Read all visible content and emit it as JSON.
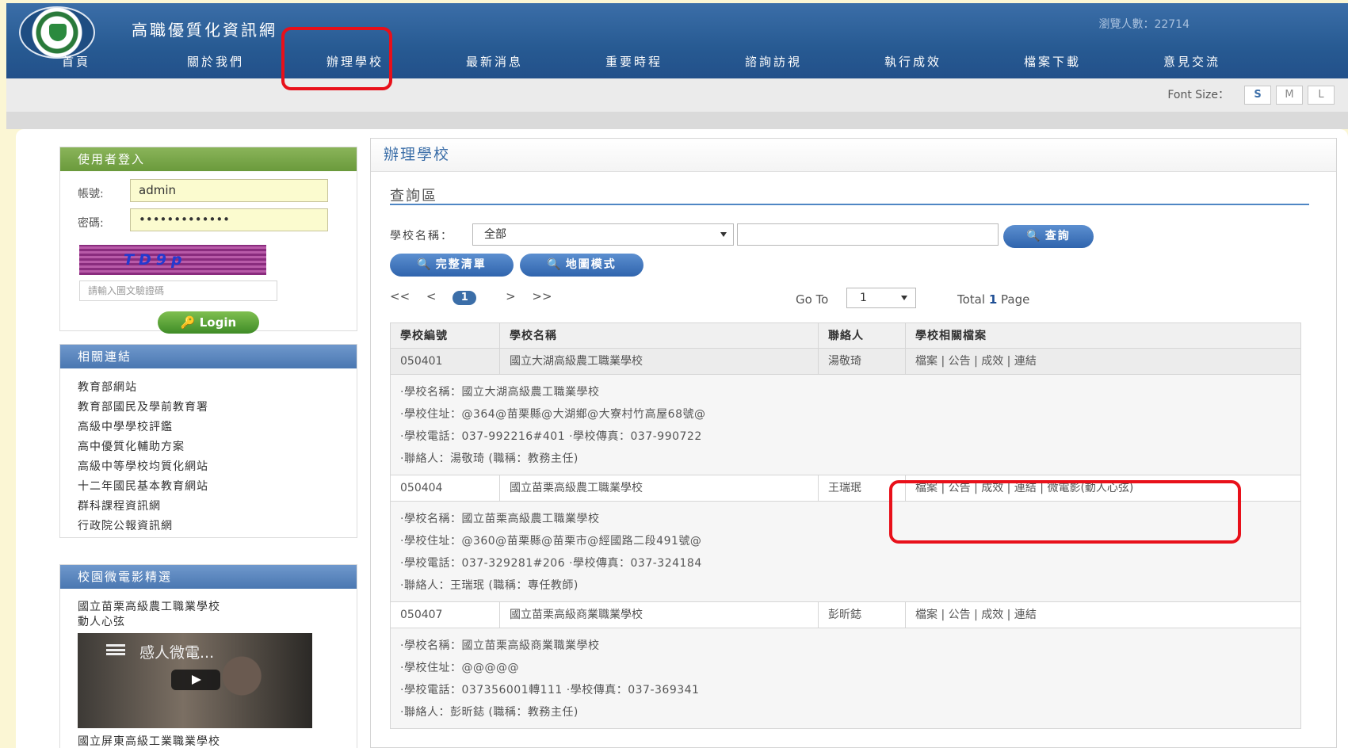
{
  "header": {
    "site_title": "高職優質化資訊網",
    "visitor_text": "瀏覽人數：22714",
    "nav": [
      "首頁",
      "關於我們",
      "辦理學校",
      "最新消息",
      "重要時程",
      "諮詢訪視",
      "執行成效",
      "檔案下載",
      "意見交流"
    ]
  },
  "fontbar": {
    "label": "Font Size：",
    "sizes": [
      "S",
      "M",
      "L"
    ]
  },
  "login": {
    "heading": "使用者登入",
    "account_label": "帳號:",
    "account_value": "admin",
    "password_label": "密碼:",
    "password_value": "•••••••••••••",
    "captcha_text": "TD9p",
    "captcha_placeholder": "請輸入圖文驗證碼",
    "login_button": "Login"
  },
  "links": {
    "heading": "相關連結",
    "items": [
      "教育部網站",
      "教育部國民及學前教育署",
      "高級中學學校評鑑",
      "高中優質化輔助方案",
      "高級中等學校均質化網站",
      "十二年國民基本教育網站",
      "群科課程資訊網",
      "行政院公報資訊網"
    ]
  },
  "video": {
    "heading": "校園微電影精選",
    "title_line1": "國立苗栗高級農工職業學校",
    "title_line2": "動人心弦",
    "caption": "感人微電...",
    "next_title": "國立屏東高級工業職業學校"
  },
  "main": {
    "title": "辦理學校",
    "query_title": "查詢區",
    "school_label": "學校名稱：",
    "school_select": "全部",
    "search_button": "查詢",
    "list_button": "完整清單",
    "map_button": "地圖模式",
    "pager": {
      "first": "<<",
      "prev": "<",
      "current": "1",
      "next": ">",
      "last": ">>"
    },
    "goto_label": "Go To",
    "goto_value": "1",
    "total_prefix": "Total",
    "total_value": "1",
    "total_suffix": "Page"
  },
  "table": {
    "headers": [
      "學校編號",
      "學校名稱",
      "聯絡人",
      "學校相關檔案"
    ],
    "rows": [
      {
        "id": "050401",
        "name": "國立大湖高級農工職業學校",
        "contact": "湯敬琦",
        "files": "檔案 | 公告 | 成效 | 連結",
        "detail_name": "·學校名稱：國立大湖高級農工職業學校",
        "detail_address": "·學校住址：@364@苗栗縣@大湖鄉@大寮村竹高屋68號@",
        "detail_phone": "·學校電話：037-992216#401 ·學校傳真：037-990722",
        "detail_contact": "·聯絡人：湯敬琦 (職稱：教務主任)"
      },
      {
        "id": "050404",
        "name": "國立苗栗高級農工職業學校",
        "contact": "王瑞珉",
        "files": "檔案 | 公告 | 成效 | 連結 | 微電影(動人心弦)",
        "detail_name": "·學校名稱：國立苗栗高級農工職業學校",
        "detail_address": "·學校住址：@360@苗栗縣@苗栗市@經國路二段491號@",
        "detail_phone": "·學校電話：037-329281#206 ·學校傳真：037-324184",
        "detail_contact": "·聯絡人：王瑞珉 (職稱：專任教師)"
      },
      {
        "id": "050407",
        "name": "國立苗栗高級商業職業學校",
        "contact": "彭昕鋕",
        "files": "檔案 | 公告 | 成效 | 連結",
        "detail_name": "·學校名稱：國立苗栗高級商業職業學校",
        "detail_address": "·學校住址：@@@@@",
        "detail_phone": "·學校電話：037356001轉111 ·學校傳真：037-369341",
        "detail_contact": "·聯絡人：彭昕鋕 (職稱：教務主任)"
      }
    ]
  },
  "colors": {
    "header_blue": "#275a92",
    "highlight_red": "#e8101a",
    "login_green": "#6a9a3c",
    "page_bg": "#fbf6d4"
  }
}
